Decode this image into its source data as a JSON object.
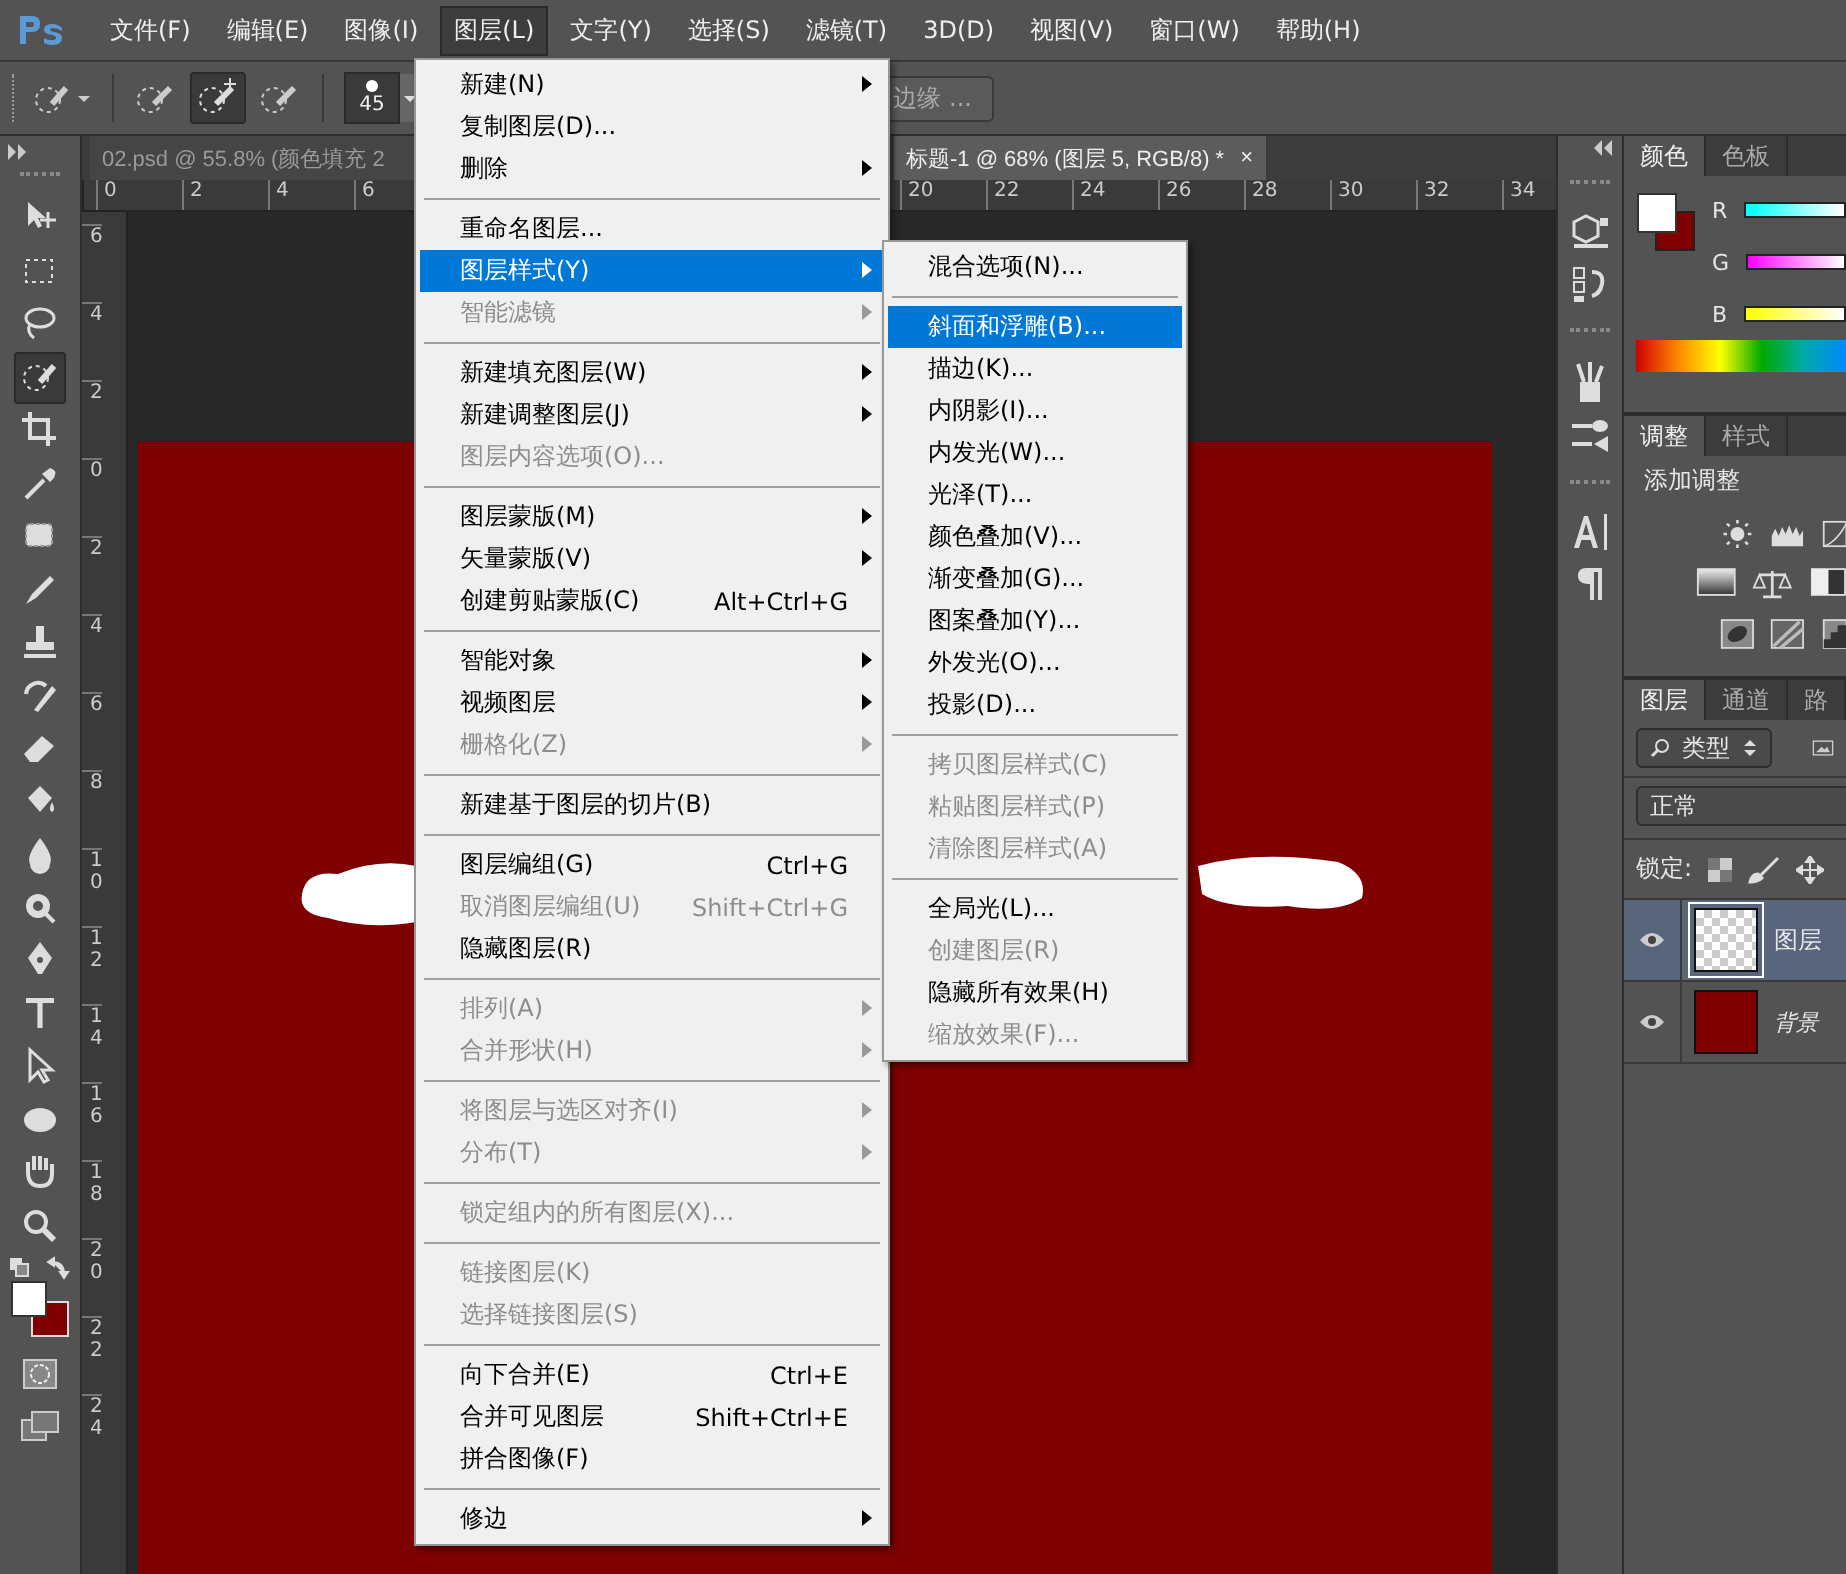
{
  "menu_bar": {
    "items": [
      {
        "label": "文件(F)",
        "selected": false
      },
      {
        "label": "编辑(E)",
        "selected": false
      },
      {
        "label": "图像(I)",
        "selected": false
      },
      {
        "label": "图层(L)",
        "selected": true
      },
      {
        "label": "文字(Y)",
        "selected": false
      },
      {
        "label": "选择(S)",
        "selected": false
      },
      {
        "label": "滤镜(T)",
        "selected": false
      },
      {
        "label": "3D(D)",
        "selected": false
      },
      {
        "label": "视图(V)",
        "selected": false
      },
      {
        "label": "窗口(W)",
        "selected": false
      },
      {
        "label": "帮助(H)",
        "selected": false
      }
    ]
  },
  "options_bar": {
    "brush_size": "45",
    "refine_edge_button": "边缘 ..."
  },
  "tools": [
    {
      "selected": false
    },
    {
      "selected": false
    },
    {
      "selected": false
    },
    {
      "selected": true
    },
    {
      "selected": false
    },
    {
      "selected": false
    },
    {
      "selected": false
    },
    {
      "selected": false
    },
    {
      "selected": false
    },
    {
      "selected": false
    },
    {
      "selected": false
    },
    {
      "selected": false
    },
    {
      "selected": false
    },
    {
      "selected": false
    },
    {
      "selected": false
    },
    {
      "selected": false
    },
    {
      "selected": false
    },
    {
      "selected": false
    },
    {
      "selected": false
    },
    {
      "selected": false
    }
  ],
  "document_tabs": [
    {
      "title": "02.psd @ 55.8% (颜色填充 2",
      "selected": false
    },
    {
      "title": "标题-1 @ 68% (图层 5, RGB/8) *",
      "selected": true,
      "close": "×"
    }
  ],
  "horizontal_ruler": {
    "left_labels": [
      "0",
      "2",
      "4",
      "6"
    ],
    "right_labels": [
      "20",
      "22",
      "24",
      "26",
      "28",
      "30",
      "32",
      "34"
    ]
  },
  "vertical_ruler": {
    "labels": [
      "6",
      "4",
      "2",
      "0",
      "2",
      "4",
      "6",
      "8",
      "10",
      "12",
      "14",
      "16",
      "18",
      "20",
      "22",
      "24"
    ]
  },
  "layer_menu": {
    "items": [
      {
        "kind": "item",
        "label": "新建(N)",
        "submenu": true,
        "disabled": false,
        "selected": false
      },
      {
        "kind": "item",
        "label": "复制图层(D)...",
        "submenu": false,
        "disabled": false,
        "selected": false
      },
      {
        "kind": "item",
        "label": "删除",
        "submenu": true,
        "disabled": false,
        "selected": false
      },
      {
        "kind": "separator"
      },
      {
        "kind": "item",
        "label": "重命名图层...",
        "submenu": false,
        "disabled": false,
        "selected": false
      },
      {
        "kind": "item",
        "label": "图层样式(Y)",
        "submenu": true,
        "disabled": false,
        "selected": true
      },
      {
        "kind": "item",
        "label": "智能滤镜",
        "submenu": true,
        "disabled": true,
        "selected": false
      },
      {
        "kind": "separator"
      },
      {
        "kind": "item",
        "label": "新建填充图层(W)",
        "submenu": true,
        "disabled": false,
        "selected": false
      },
      {
        "kind": "item",
        "label": "新建调整图层(J)",
        "submenu": true,
        "disabled": false,
        "selected": false
      },
      {
        "kind": "item",
        "label": "图层内容选项(O)...",
        "submenu": false,
        "disabled": true,
        "selected": false
      },
      {
        "kind": "separator"
      },
      {
        "kind": "item",
        "label": "图层蒙版(M)",
        "submenu": true,
        "disabled": false,
        "selected": false
      },
      {
        "kind": "item",
        "label": "矢量蒙版(V)",
        "submenu": true,
        "disabled": false,
        "selected": false
      },
      {
        "kind": "item",
        "label": "创建剪贴蒙版(C)",
        "shortcut": "Alt+Ctrl+G",
        "submenu": false,
        "disabled": false,
        "selected": false
      },
      {
        "kind": "separator"
      },
      {
        "kind": "item",
        "label": "智能对象",
        "submenu": true,
        "disabled": false,
        "selected": false
      },
      {
        "kind": "item",
        "label": "视频图层",
        "submenu": true,
        "disabled": false,
        "selected": false
      },
      {
        "kind": "item",
        "label": "栅格化(Z)",
        "submenu": true,
        "disabled": true,
        "selected": false
      },
      {
        "kind": "separator"
      },
      {
        "kind": "item",
        "label": "新建基于图层的切片(B)",
        "submenu": false,
        "disabled": false,
        "selected": false
      },
      {
        "kind": "separator"
      },
      {
        "kind": "item",
        "label": "图层编组(G)",
        "shortcut": "Ctrl+G",
        "submenu": false,
        "disabled": false,
        "selected": false
      },
      {
        "kind": "item",
        "label": "取消图层编组(U)",
        "shortcut": "Shift+Ctrl+G",
        "submenu": false,
        "disabled": true,
        "selected": false
      },
      {
        "kind": "item",
        "label": "隐藏图层(R)",
        "submenu": false,
        "disabled": false,
        "selected": false
      },
      {
        "kind": "separator"
      },
      {
        "kind": "item",
        "label": "排列(A)",
        "submenu": true,
        "disabled": true,
        "selected": false
      },
      {
        "kind": "item",
        "label": "合并形状(H)",
        "submenu": true,
        "disabled": true,
        "selected": false
      },
      {
        "kind": "separator"
      },
      {
        "kind": "item",
        "label": "将图层与选区对齐(I)",
        "submenu": true,
        "disabled": true,
        "selected": false
      },
      {
        "kind": "item",
        "label": "分布(T)",
        "submenu": true,
        "disabled": true,
        "selected": false
      },
      {
        "kind": "separator"
      },
      {
        "kind": "item",
        "label": "锁定组内的所有图层(X)...",
        "submenu": false,
        "disabled": true,
        "selected": false
      },
      {
        "kind": "separator"
      },
      {
        "kind": "item",
        "label": "链接图层(K)",
        "submenu": false,
        "disabled": true,
        "selected": false
      },
      {
        "kind": "item",
        "label": "选择链接图层(S)",
        "submenu": false,
        "disabled": true,
        "selected": false
      },
      {
        "kind": "separator"
      },
      {
        "kind": "item",
        "label": "向下合并(E)",
        "shortcut": "Ctrl+E",
        "submenu": false,
        "disabled": false,
        "selected": false
      },
      {
        "kind": "item",
        "label": "合并可见图层",
        "shortcut": "Shift+Ctrl+E",
        "submenu": false,
        "disabled": false,
        "selected": false
      },
      {
        "kind": "item",
        "label": "拼合图像(F)",
        "submenu": false,
        "disabled": false,
        "selected": false
      },
      {
        "kind": "separator"
      },
      {
        "kind": "item",
        "label": "修边",
        "submenu": true,
        "disabled": false,
        "selected": false
      }
    ]
  },
  "layer_style_submenu": {
    "items": [
      {
        "kind": "item",
        "label": "混合选项(N)...",
        "submenu": false,
        "disabled": false,
        "selected": false
      },
      {
        "kind": "separator"
      },
      {
        "kind": "item",
        "label": "斜面和浮雕(B)...",
        "submenu": false,
        "disabled": false,
        "selected": true
      },
      {
        "kind": "item",
        "label": "描边(K)...",
        "submenu": false,
        "disabled": false,
        "selected": false
      },
      {
        "kind": "item",
        "label": "内阴影(I)...",
        "submenu": false,
        "disabled": false,
        "selected": false
      },
      {
        "kind": "item",
        "label": "内发光(W)...",
        "submenu": false,
        "disabled": false,
        "selected": false
      },
      {
        "kind": "item",
        "label": "光泽(T)...",
        "submenu": false,
        "disabled": false,
        "selected": false
      },
      {
        "kind": "item",
        "label": "颜色叠加(V)...",
        "submenu": false,
        "disabled": false,
        "selected": false
      },
      {
        "kind": "item",
        "label": "渐变叠加(G)...",
        "submenu": false,
        "disabled": false,
        "selected": false
      },
      {
        "kind": "item",
        "label": "图案叠加(Y)...",
        "submenu": false,
        "disabled": false,
        "selected": false
      },
      {
        "kind": "item",
        "label": "外发光(O)...",
        "submenu": false,
        "disabled": false,
        "selected": false
      },
      {
        "kind": "item",
        "label": "投影(D)...",
        "submenu": false,
        "disabled": false,
        "selected": false
      },
      {
        "kind": "separator"
      },
      {
        "kind": "item",
        "label": "拷贝图层样式(C)",
        "submenu": false,
        "disabled": true,
        "selected": false
      },
      {
        "kind": "item",
        "label": "粘贴图层样式(P)",
        "submenu": false,
        "disabled": true,
        "selected": false
      },
      {
        "kind": "item",
        "label": "清除图层样式(A)",
        "submenu": false,
        "disabled": true,
        "selected": false
      },
      {
        "kind": "separator"
      },
      {
        "kind": "item",
        "label": "全局光(L)...",
        "submenu": false,
        "disabled": false,
        "selected": false
      },
      {
        "kind": "item",
        "label": "创建图层(R)",
        "submenu": false,
        "disabled": true,
        "selected": false
      },
      {
        "kind": "item",
        "label": "隐藏所有效果(H)",
        "submenu": false,
        "disabled": false,
        "selected": false
      },
      {
        "kind": "item",
        "label": "缩放效果(F)...",
        "submenu": false,
        "disabled": true,
        "selected": false
      }
    ]
  },
  "panels": {
    "color": {
      "tabs": [
        {
          "label": "颜色",
          "selected": true
        },
        {
          "label": "色板",
          "selected": false
        }
      ],
      "channels": [
        "R",
        "G",
        "B"
      ]
    },
    "adjustments": {
      "tabs": [
        {
          "label": "调整",
          "selected": true
        },
        {
          "label": "样式",
          "selected": false
        }
      ],
      "heading": "添加调整"
    },
    "layers": {
      "tabs": [
        {
          "label": "图层",
          "selected": true
        },
        {
          "label": "通道",
          "selected": false
        },
        {
          "label": "路",
          "selected": false
        }
      ],
      "filter": "类型",
      "blend_mode": "正常",
      "lock_label": "锁定:",
      "layers": [
        {
          "name": "图层",
          "kind": "transparent",
          "selected": true,
          "visible": true
        },
        {
          "name": "背景",
          "kind": "fill",
          "selected": false,
          "visible": true
        }
      ]
    }
  }
}
